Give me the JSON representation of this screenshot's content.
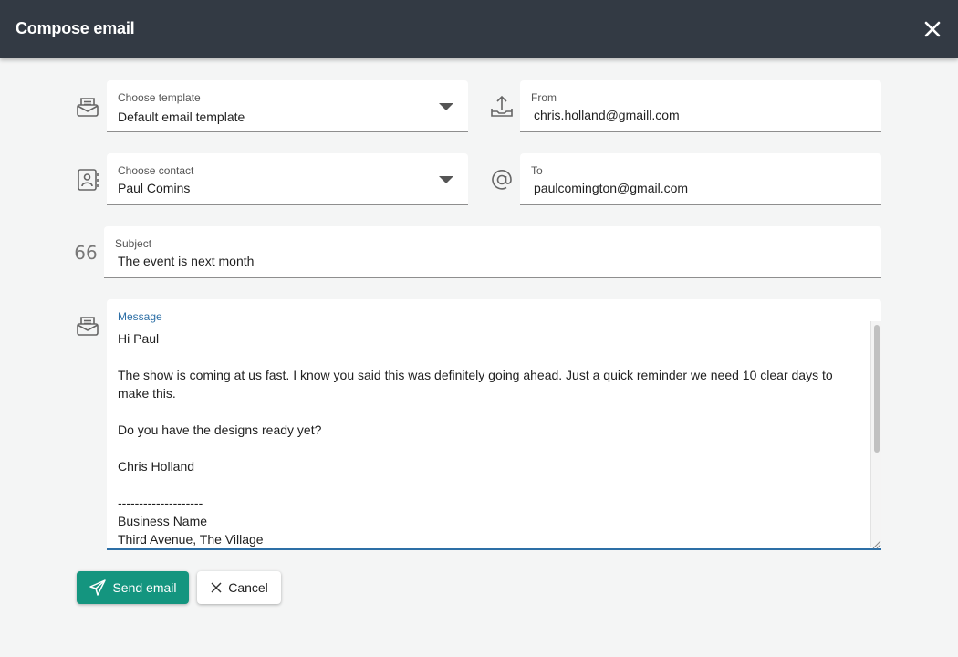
{
  "dialog": {
    "title": "Compose email",
    "close_icon": "close-icon"
  },
  "template": {
    "icon": "envelope-tray-icon",
    "label": "Choose template",
    "value": "Default email template"
  },
  "from": {
    "icon": "upload-tray-icon",
    "label": "From",
    "value": "chris.holland@gmaill.com"
  },
  "contact": {
    "icon": "contact-card-icon",
    "label": "Choose contact",
    "value": "Paul Comins"
  },
  "to": {
    "icon": "at-sign-icon",
    "label": "To",
    "value": "paulcomington@gmail.com"
  },
  "subject": {
    "icon": "quote-icon",
    "icon_glyph": "66",
    "label": "Subject",
    "value": "The event is next month"
  },
  "message": {
    "icon": "envelope-tray-icon",
    "label": "Message",
    "lines": [
      "Hi Paul",
      "",
      "The show is coming at us fast. I know you said this was definitely going ahead. Just a quick reminder we need 10 clear days to make this.",
      "",
      "Do you have the designs ready yet?",
      "",
      "Chris Holland",
      "",
      "--------------------",
      "Business Name",
      "Third Avenue, The Village"
    ]
  },
  "actions": {
    "send_label": "Send email",
    "send_icon": "paper-plane-icon",
    "cancel_label": "Cancel",
    "cancel_icon": "x-icon"
  },
  "colors": {
    "titlebar": "#333a44",
    "send_button": "#14957f",
    "message_accent": "#2d6fa6"
  }
}
